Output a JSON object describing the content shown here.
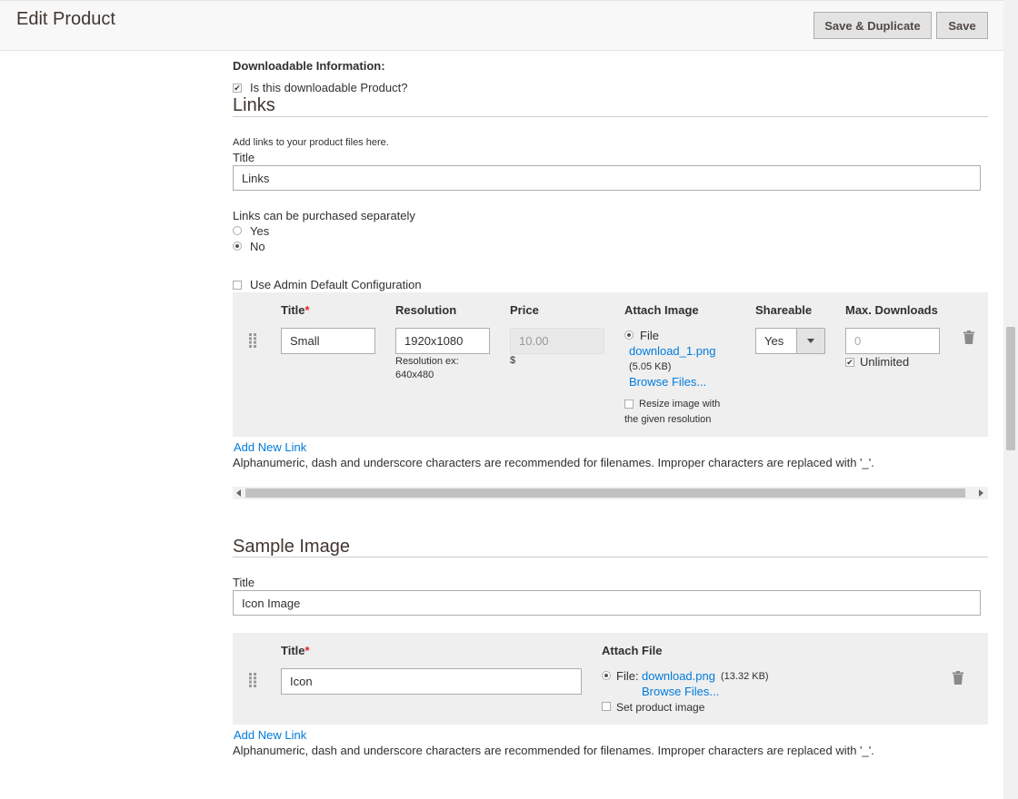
{
  "header": {
    "title": "Edit Product",
    "save_duplicate_label": "Save & Duplicate",
    "save_label": "Save"
  },
  "downloadable": {
    "heading": "Downloadable Information:",
    "is_downloadable_label": "Is this downloadable Product?",
    "is_downloadable_checked": true
  },
  "links": {
    "section_title": "Links",
    "hint": "Add links to your product files here.",
    "title_label": "Title",
    "title_value": "Links",
    "purchase_label": "Links can be purchased separately",
    "yes_label": "Yes",
    "no_label": "No",
    "selected": "No",
    "use_default_label": "Use Admin Default Configuration",
    "columns": {
      "title": "Title",
      "required_mark": "*",
      "resolution": "Resolution",
      "price": "Price",
      "attach_image": "Attach Image",
      "shareable": "Shareable",
      "max_downloads": "Max. Downloads"
    },
    "row": {
      "title": "Small",
      "resolution": "1920x1080",
      "resolution_hint_1": "Resolution ex:",
      "resolution_hint_2": "640x480",
      "price_placeholder": "10.00",
      "currency": "$",
      "file_label": "File",
      "file_name": "download_1.png",
      "file_size": "(5.05 KB)",
      "browse": "Browse Files...",
      "resize_label_1": "Resize image with",
      "resize_label_2": "the given resolution",
      "shareable_value": "Yes",
      "max_downloads_placeholder": "0",
      "unlimited_label": "Unlimited"
    },
    "add_new_link": "Add New Link",
    "filename_note": "Alphanumeric, dash and underscore characters are recommended for filenames. Improper characters are replaced with '_'."
  },
  "sample": {
    "section_title": "Sample Image",
    "title_label": "Title",
    "title_value": "Icon Image",
    "columns": {
      "title": "Title",
      "required_mark": "*",
      "attach_file": "Attach File"
    },
    "row": {
      "title": "Icon",
      "file_label": "File:",
      "file_name": "download.png",
      "file_size": "(13.32 KB)",
      "browse": "Browse Files...",
      "set_image_label": "Set product image"
    },
    "add_new_link": "Add New Link",
    "filename_note": "Alphanumeric, dash and underscore characters are recommended for filenames. Improper characters are replaced with '_'."
  },
  "colors": {
    "link": "#007bdb",
    "required": "#e22626",
    "panel": "#efefef"
  }
}
